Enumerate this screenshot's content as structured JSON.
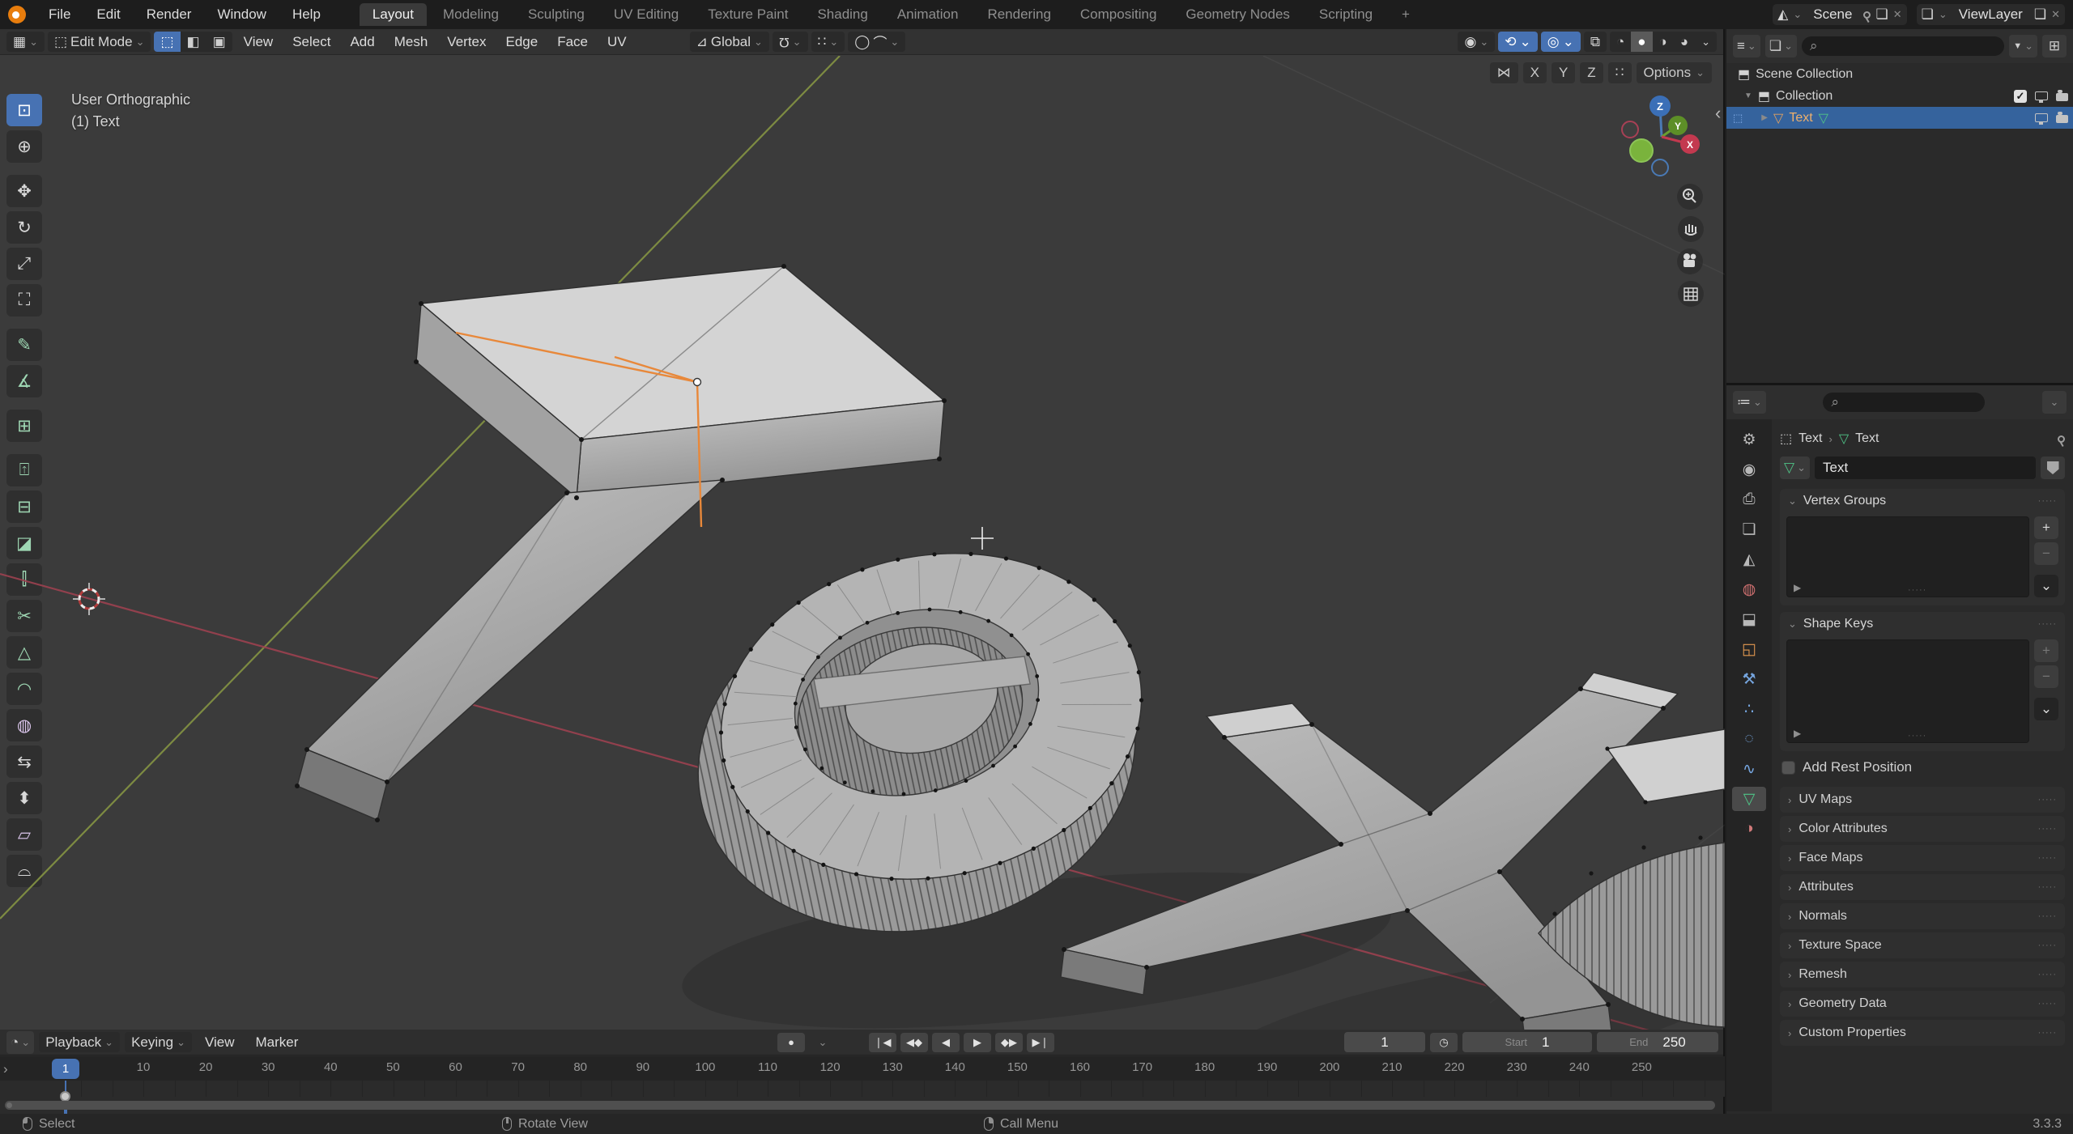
{
  "topbar": {
    "menus": [
      "File",
      "Edit",
      "Render",
      "Window",
      "Help"
    ],
    "workspaces": [
      "Layout",
      "Modeling",
      "Sculpting",
      "UV Editing",
      "Texture Paint",
      "Shading",
      "Animation",
      "Rendering",
      "Compositing",
      "Geometry Nodes",
      "Scripting",
      "+"
    ],
    "scene_name": "Scene",
    "viewlayer_name": "ViewLayer"
  },
  "viewport_header": {
    "mode": "Edit Mode",
    "menus": [
      "View",
      "Select",
      "Add",
      "Mesh",
      "Vertex",
      "Edge",
      "Face",
      "UV"
    ],
    "orientation": "Global",
    "axes": [
      "X",
      "Y",
      "Z"
    ],
    "options_label": "Options"
  },
  "viewport": {
    "view_label": "User Orthographic",
    "object_label": "(1) Text",
    "gizmo_axis_labels": [
      "Z",
      "Y",
      "X"
    ]
  },
  "toolbar": {
    "tools": [
      {
        "name": "select-box",
        "glyph": "⊡"
      },
      {
        "name": "cursor",
        "glyph": "⊕"
      },
      {
        "name": "move",
        "glyph": "✥"
      },
      {
        "name": "rotate",
        "glyph": "↻"
      },
      {
        "name": "scale",
        "glyph": "⤢"
      },
      {
        "name": "transform",
        "glyph": "⛶"
      },
      {
        "name": "annotate",
        "glyph": "✎"
      },
      {
        "name": "measure",
        "glyph": "∡"
      },
      {
        "name": "add-cube",
        "glyph": "⊞"
      },
      {
        "name": "extrude-region",
        "glyph": "⍐"
      },
      {
        "name": "inset-faces",
        "glyph": "⊟"
      },
      {
        "name": "bevel",
        "glyph": "◪"
      },
      {
        "name": "loop-cut",
        "glyph": "⫿"
      },
      {
        "name": "knife",
        "glyph": "✂"
      },
      {
        "name": "poly-build",
        "glyph": "△"
      },
      {
        "name": "spin",
        "glyph": "◠"
      },
      {
        "name": "smooth",
        "glyph": "◍"
      },
      {
        "name": "edge-slide",
        "glyph": "⇆"
      },
      {
        "name": "shrink-fatten",
        "glyph": "⬍"
      },
      {
        "name": "shear",
        "glyph": "▱"
      },
      {
        "name": "rip-region",
        "glyph": "⌓"
      }
    ]
  },
  "outliner": {
    "rows": [
      {
        "label": "Scene Collection"
      },
      {
        "label": "Collection"
      },
      {
        "label": "Text"
      }
    ]
  },
  "properties": {
    "breadcrumb": {
      "object": "Text",
      "data": "Text"
    },
    "name_field": "Text",
    "panels": {
      "vertex_groups": "Vertex Groups",
      "shape_keys": "Shape Keys",
      "add_rest_position": "Add Rest Position"
    },
    "collapsed_panels": [
      "UV Maps",
      "Color Attributes",
      "Face Maps",
      "Attributes",
      "Normals",
      "Texture Space",
      "Remesh",
      "Geometry Data",
      "Custom Properties"
    ]
  },
  "timeline": {
    "menus": [
      "Playback",
      "Keying",
      "View",
      "Marker"
    ],
    "current_frame": "1",
    "start_label": "Start",
    "start_value": "1",
    "end_label": "End",
    "end_value": "250",
    "ticks": [
      "10",
      "20",
      "30",
      "40",
      "50",
      "60",
      "70",
      "80",
      "90",
      "100",
      "110",
      "120",
      "130",
      "140",
      "150",
      "160",
      "170",
      "180",
      "190",
      "200",
      "210",
      "220",
      "230",
      "240",
      "250"
    ]
  },
  "statusbar": {
    "hints": [
      "Select",
      "Rotate View",
      "Call Menu"
    ],
    "version": "3.3.3"
  },
  "icons": {
    "dropdown": "⌄",
    "search": "⌕",
    "close": "✕",
    "copy": "❏",
    "pin": "css-shape",
    "check": "✓",
    "funnel": "▼",
    "new_collection": "⊞",
    "collapse_left": "‹",
    "ruler_arrow": "›",
    "panel_grip": "·····",
    "expand_right": "▸",
    "collapse_open": "⌄",
    "collapse_closed": "›",
    "plus": "+",
    "minus": "−",
    "record": "●",
    "jump_start": "❘◀",
    "prev_keyframe": "◀◆",
    "play_reverse": "◀",
    "play": "▶",
    "next_keyframe": "◆▶",
    "jump_end": "▶❘",
    "stopwatch": "◷",
    "scene": "◭",
    "viewlayer": "❏",
    "editor_viewport": "▦",
    "editor_outliner": "≡",
    "editor_properties": "≔",
    "editor_timeline": "◔",
    "edit_mode": "⬚",
    "mode_vertex": "⬚",
    "mode_edge": "◧",
    "mode_face": "▣",
    "orientation": "⊿",
    "snap_magnet": "Ω",
    "snap_target": "∷",
    "proportional": "◯",
    "falloff": "⌒",
    "visibility": "◉",
    "gizmos": "⟲",
    "overlays": "◎",
    "xray": "⧉",
    "shading_wireframe": "◔",
    "shading_solid": "●",
    "shading_material": "◑",
    "shading_rendered": "◕",
    "mirror": "⋈",
    "box": "⬒",
    "tri_down": "▼",
    "tri_right": "▶",
    "mesh_data": "▽",
    "object_brackets": "⬚",
    "tabs": {
      "tool": "⚙",
      "render": "◉",
      "output": "⎙",
      "view_layer": "❏",
      "scene": "◭",
      "world": "◍",
      "collection": "⬓",
      "object": "◱",
      "modifiers": "⚒",
      "particles": "∴",
      "physics": "◌",
      "constraints": "∿",
      "data": "▽",
      "material": "◑"
    }
  },
  "colors": {
    "accent": "#4772b3",
    "selection_row": "#35639d",
    "active_object_text": "#eeb06c",
    "axis_x": "#c3394f",
    "axis_y": "#6a9d2f",
    "axis_z": "#3b6fb7",
    "active_edge": "#e8883a"
  }
}
